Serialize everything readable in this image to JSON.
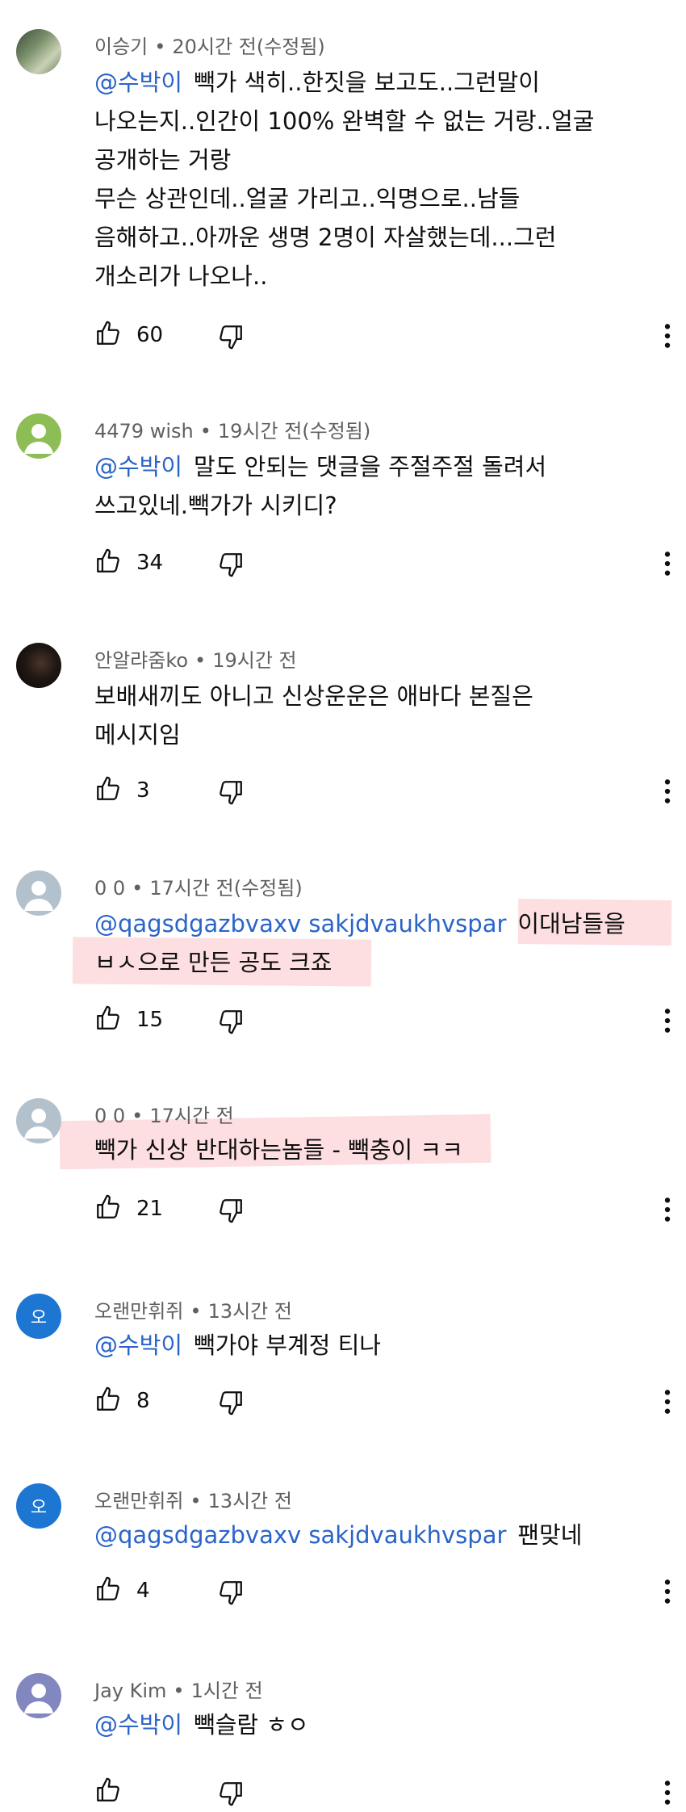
{
  "comments": [
    {
      "author": "이승기",
      "time": "20시간 전(수정됨)",
      "lines": [
        {
          "mention": "@수박이",
          "text": "빽가 색히..한짓을 보고도..그런말이"
        },
        {
          "mention": "",
          "text": "나오는지..인간이 100% 완벽할 수 없는 거랑..얼굴"
        },
        {
          "mention": "",
          "text": "공개하는 거랑"
        },
        {
          "mention": "",
          "text": "무슨 상관인데..얼굴 가리고..익명으로..남들"
        },
        {
          "mention": "",
          "text": "음해하고..아까운 생명 2명이 자살했는데...그런"
        },
        {
          "mention": "",
          "text": "개소리가 나오나.."
        }
      ],
      "likes": "60"
    },
    {
      "author": "4479 wish",
      "time": "19시간 전(수정됨)",
      "lines": [
        {
          "mention": "@수박이",
          "text": "말도 안되는 댓글을  주절주절 돌려서"
        },
        {
          "mention": "",
          "text": "쓰고있네.빽가가 시키디?"
        }
      ],
      "likes": "34"
    },
    {
      "author": "안알랴줌ko",
      "time": "19시간 전",
      "lines": [
        {
          "mention": "",
          "text": "보배새끼도 아니고 신상운운은 애바다 본질은"
        },
        {
          "mention": "",
          "text": "메시지임"
        }
      ],
      "likes": "3"
    },
    {
      "author": "0 0",
      "time": "17시간 전(수정됨)",
      "lines": [
        {
          "mention": "@qagsdgazbvaxv sakjdvaukhvspar",
          "text": "이대남들을"
        },
        {
          "mention": "",
          "text": "ㅂㅅ으로 만든 공도 크죠"
        }
      ],
      "likes": "15"
    },
    {
      "author": "0 0",
      "time": "17시간 전",
      "lines": [
        {
          "mention": "",
          "text": "빽가 신상 반대하는놈들 - 빽충이 ㅋㅋ"
        }
      ],
      "likes": "21"
    },
    {
      "author": "오랜만휘쥐",
      "avatar_letter": "오",
      "time": "13시간 전",
      "lines": [
        {
          "mention": "@수박이",
          "text": "빽가야 부계정 티나"
        }
      ],
      "likes": "8"
    },
    {
      "author": "오랜만휘쥐",
      "avatar_letter": "오",
      "time": "13시간 전",
      "lines": [
        {
          "mention": "@qagsdgazbvaxv sakjdvaukhvspar",
          "text": "팬맞네"
        }
      ],
      "likes": "4"
    },
    {
      "author": "Jay Kim",
      "time": "1시간 전",
      "lines": [
        {
          "mention": "@수박이",
          "text": "빽슬람 ㅎㅇ"
        }
      ],
      "likes": ""
    }
  ],
  "meta_separator": "•",
  "icons": {
    "like": "thumbs-up-icon",
    "dislike": "thumbs-down-icon",
    "more": "more-vert-icon",
    "avatar_default": "person-icon"
  },
  "colors": {
    "mention": "#2a64c9",
    "meta": "#606060",
    "highlight": "#fcc3c8",
    "avatar_letter": "#1c76d2"
  }
}
